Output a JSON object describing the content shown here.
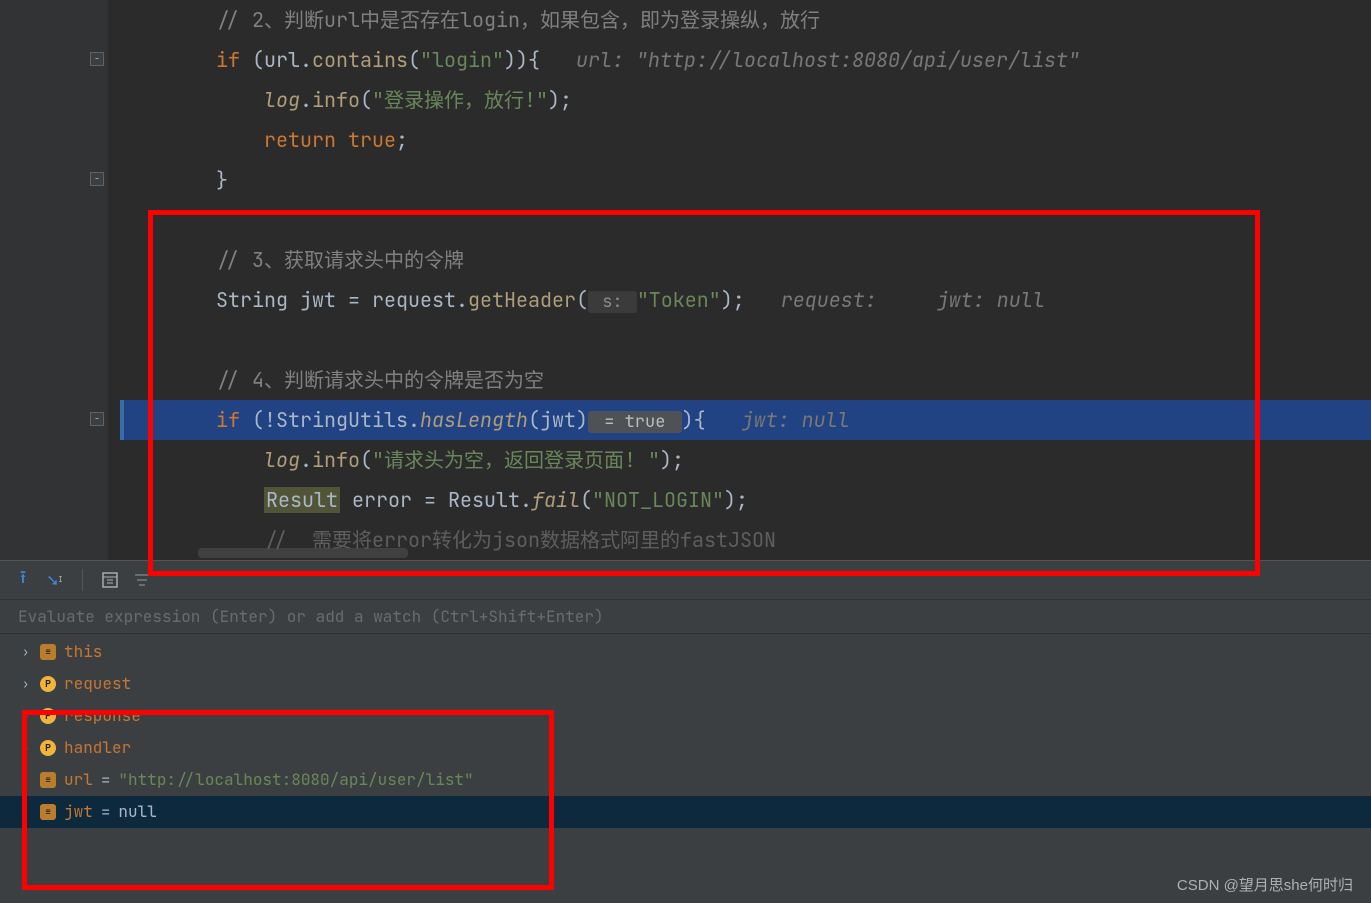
{
  "code": {
    "l6": "// 2、判断url中是否存在login，如果包含，即为登录操纵，放行",
    "l7_kw": "if ",
    "l7_a": "(url.",
    "l7_call": "contains",
    "l7_b": "(",
    "l7_str": "\"login\"",
    "l7_c": ")){   ",
    "l7_hint": "url: \"http://localhost:8080/api/user/list\"",
    "l8_a": "log",
    "l8_b": ".",
    "l8_call": "info",
    "l8_c": "(",
    "l8_str": "\"登录操作，放行!\"",
    "l8_d": ");",
    "l9_kw": "return true",
    "l9_b": ";",
    "l10": "}",
    "l12": "// 3、获取请求头中的令牌",
    "l13_a": "String jwt = request.",
    "l13_call": "getHeader",
    "l13_b": "(",
    "l13_hintbox": " s: ",
    "l13_str": "\"Token\"",
    "l13_c": ");   ",
    "l13_hint1": "request:",
    "l13_hint2": "jwt: null",
    "l15": "// 4、判断请求头中的令牌是否为空",
    "l16_kw": "if ",
    "l16_a": "(!StringUtils.",
    "l16_call": "hasLength",
    "l16_b": "(jwt)",
    "l16_eval": " = true ",
    "l16_c": "){   ",
    "l16_hint": "jwt: null",
    "l17_a": "log",
    "l17_b": ".",
    "l17_call": "info",
    "l17_c": "(",
    "l17_str": "\"请求头为空，返回登录页面! \"",
    "l17_d": ");",
    "l18_res": "Result",
    "l18_a": " error = Result.",
    "l18_call": "fail",
    "l18_b": "(",
    "l18_str": "\"NOT_LOGIN\"",
    "l18_c": ");",
    "l19": "//  需要将error转化为json数据格式阿里的fastJSON"
  },
  "eval_placeholder": "Evaluate expression (Enter) or add a watch (Ctrl+Shift+Enter)",
  "vars": {
    "this": "this",
    "request": "request",
    "response": "response",
    "handler": "handler",
    "url_name": "url",
    "url_eq": " = ",
    "url_val": "\"http://localhost:8080/api/user/list\"",
    "jwt_name": "jwt",
    "jwt_eq": " = ",
    "jwt_val": "null"
  },
  "watermark": "CSDN @望月思she何时归"
}
